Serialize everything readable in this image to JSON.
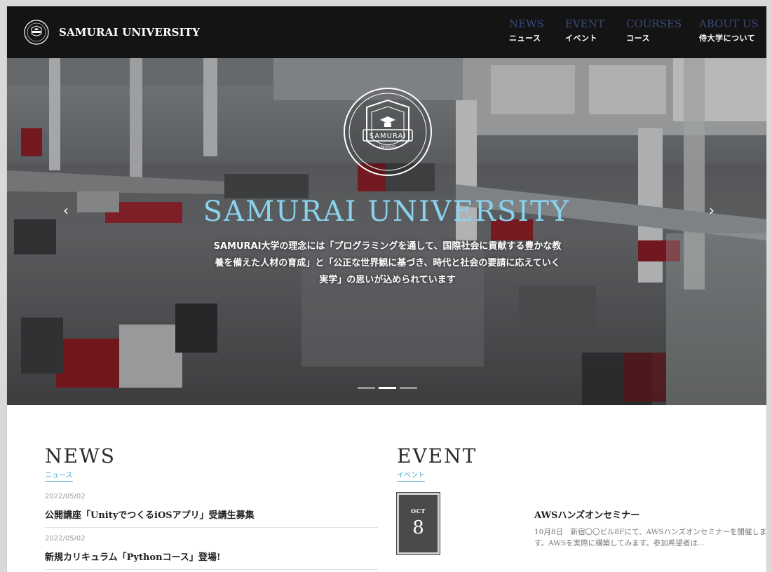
{
  "brand": {
    "name": "SAMURAI UNIVERSITY"
  },
  "nav": {
    "items": [
      {
        "en": "NEWS",
        "jp": "ニュース"
      },
      {
        "en": "EVENT",
        "jp": "イベント"
      },
      {
        "en": "COURSES",
        "jp": "コース"
      },
      {
        "en": "ABOUT US",
        "jp": "侍大学について"
      }
    ]
  },
  "hero": {
    "emblem_text": "SAMURAI",
    "emblem_small": "UNIVERSITY",
    "title": "SAMURAI UNIVERSITY",
    "text": "SAMURAI大学の理念には「プログラミングを通して、国際社会に貢献する豊かな教養を備えた人材の育成」と「公正な世界観に基づき、時代と社会の要請に応えていく実学」の思いが込められています",
    "prev_icon": "‹",
    "next_icon": "›",
    "slides": 3,
    "active_slide": 2
  },
  "news": {
    "title": "NEWS",
    "subtitle": "ニュース",
    "items": [
      {
        "date": "2022/05/02",
        "title": "公開講座「UnityでつくるiOSアプリ」受講生募集"
      },
      {
        "date": "2022/05/02",
        "title": "新規カリキュラム「Pythonコース」登場!"
      }
    ]
  },
  "event": {
    "title": "EVENT",
    "subtitle": "イベント",
    "items": [
      {
        "month": "OCT",
        "day": "8",
        "title": "AWSハンズオンセミナー",
        "desc": "10月8日　新宿〇〇ビル8Fにて、AWSハンズオンセミナーを開催します。AWSを実際に構築してみます。参加希望者は..."
      }
    ]
  },
  "colors": {
    "nav_bg": "#141414",
    "hero_title": "#8ad2ee",
    "accent": "#4aa6cf"
  }
}
